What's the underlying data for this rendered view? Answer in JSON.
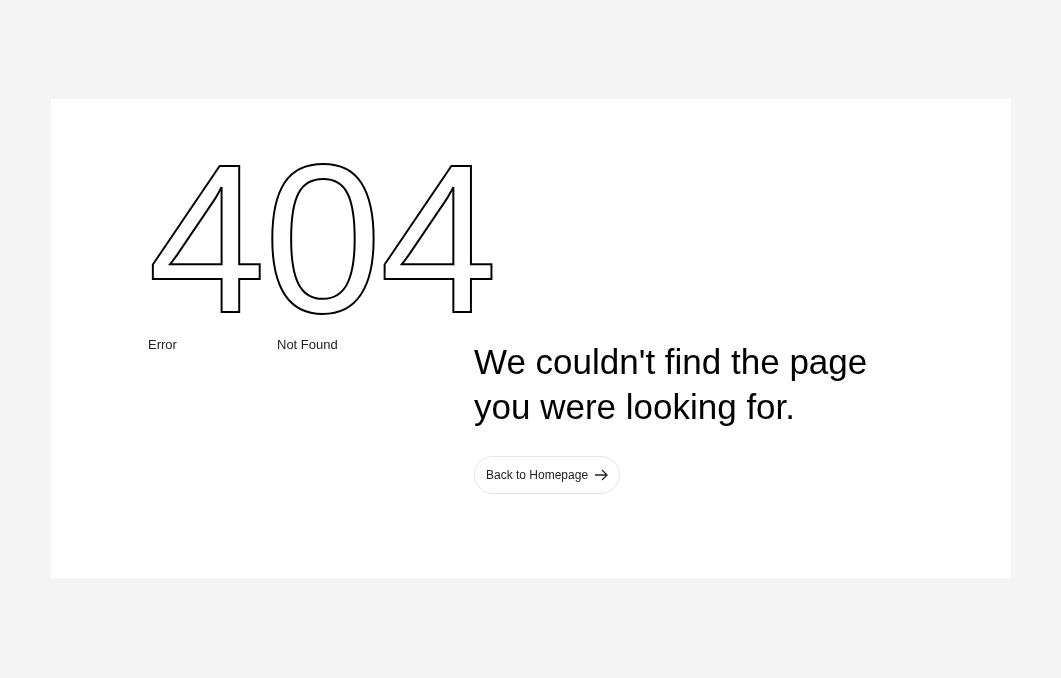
{
  "code": "404",
  "labels": [
    "Error",
    "Not Found"
  ],
  "heading": "We couldn't find the page you were looking for.",
  "button": {
    "label": "Back to Homepage"
  }
}
